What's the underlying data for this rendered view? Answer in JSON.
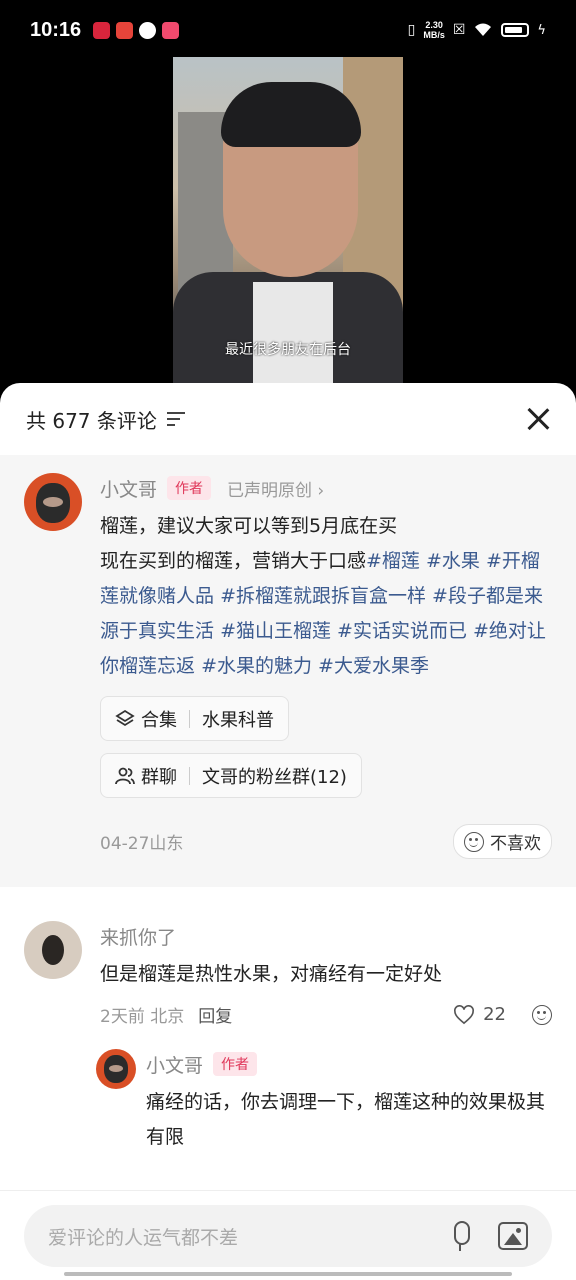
{
  "status_bar": {
    "time": "10:16",
    "app_icons": [
      "app-icon-red",
      "app-icon-news",
      "app-icon-circle",
      "app-icon-pink"
    ],
    "net_speed_value": "2.30",
    "net_speed_unit": "MB/s"
  },
  "video": {
    "subtitle": "最近很多朋友在后台"
  },
  "sheet": {
    "title": "共 677 条评论"
  },
  "pinned_comment": {
    "username": "小文哥",
    "author_badge": "作者",
    "original_tag": "已声明原创",
    "text_plain": "榴莲，建议大家可以等到5月底在买",
    "text_line2": "现在买到的榴莲，营销大于口感",
    "hashtags": [
      "#榴莲",
      "#水果",
      "#开榴莲就像赌人品",
      "#拆榴莲就跟拆盲盒一样",
      "#段子都是来源于真实生活",
      "#猫山王榴莲",
      "#实话实说而已",
      "#绝对让你榴莲忘返",
      "#水果的魅力",
      "#大爱水果季"
    ],
    "collection_label": "合集",
    "collection_name": "水果科普",
    "group_label": "群聊",
    "group_name": "文哥的粉丝群(12)",
    "meta": "04-27山东",
    "dislike_label": "不喜欢"
  },
  "comments": [
    {
      "username": "来抓你了",
      "text": "但是榴莲是热性水果，对痛经有一定好处",
      "meta": "2天前 北京",
      "reply_label": "回复",
      "likes": "22"
    }
  ],
  "reply": {
    "username": "小文哥",
    "author_badge": "作者",
    "text": "痛经的话，你去调理一下，榴莲这种的效果极其有限"
  },
  "input": {
    "placeholder": "爱评论的人运气都不差"
  },
  "colors": {
    "hashtag": "#3b5a8f",
    "author_badge": "#e0385a"
  }
}
